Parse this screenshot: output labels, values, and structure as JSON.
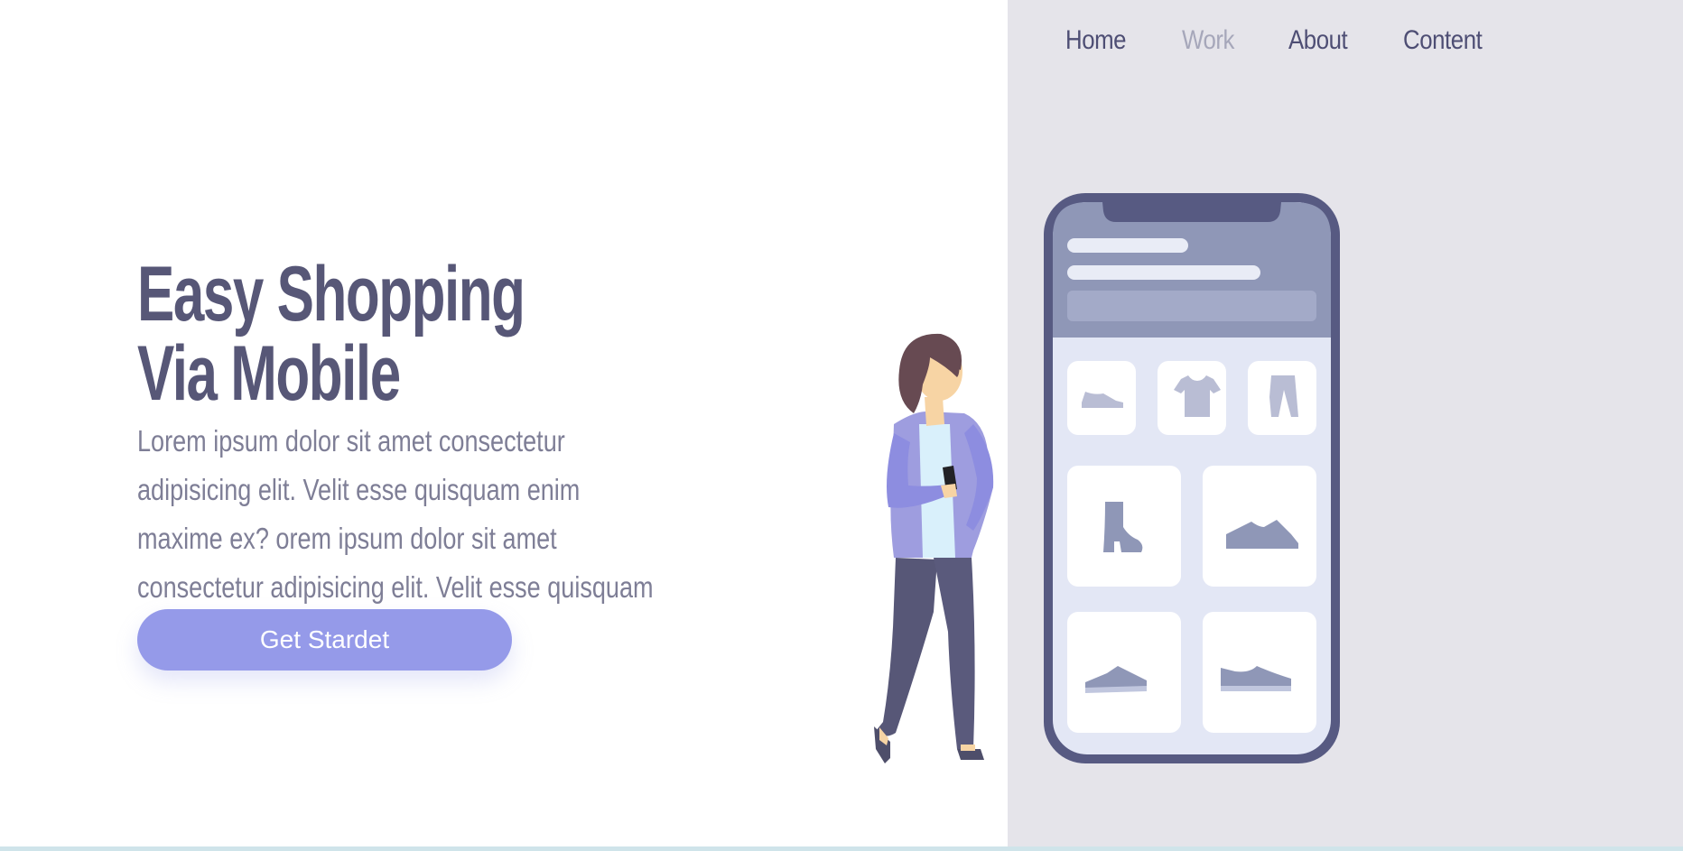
{
  "nav": {
    "items": [
      {
        "label": "Home",
        "active": false
      },
      {
        "label": "Work",
        "active": true
      },
      {
        "label": "About",
        "active": false
      },
      {
        "label": "Content",
        "active": false
      }
    ]
  },
  "hero": {
    "title_line1": "Easy Shopping",
    "title_line2": "Via Mobile",
    "description": "Lorem ipsum dolor sit amet consectetur adipisicing elit. Velit esse quisquam enim maxime ex? orem ipsum dolor sit amet consectetur adipisicing elit. Velit esse quisquam enim maxime ex? recusandae!",
    "cta_label": "Get Stardet"
  },
  "illustration": {
    "product_icons": [
      "sneaker-icon",
      "tshirt-icon",
      "pants-icon",
      "boot-icon",
      "shoe-icon",
      "flat-shoe-icon",
      "loafer-icon"
    ]
  },
  "colors": {
    "right_panel": "#e5e4ea",
    "title": "#575777",
    "text": "#7e7e96",
    "nav": "#4e4e74",
    "nav_active": "#a6a7ba",
    "accent": "#959ae9",
    "phone_frame": "#575a82"
  }
}
